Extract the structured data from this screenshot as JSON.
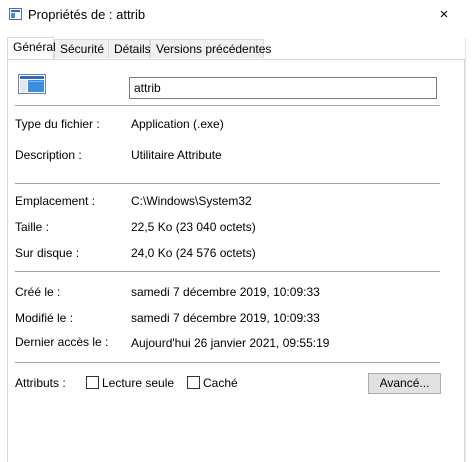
{
  "window": {
    "title": "Propriétés de : attrib",
    "close_glyph": "×"
  },
  "tabs": [
    {
      "label": "Général",
      "active": true
    },
    {
      "label": "Sécurité",
      "active": false
    },
    {
      "label": "Détails",
      "active": false
    },
    {
      "label": "Versions précédentes",
      "active": false
    }
  ],
  "general": {
    "icon": "application-window-icon",
    "file_name": "attrib",
    "rows": [
      {
        "label": "Type du fichier :",
        "value": "Application (.exe)"
      },
      {
        "label": "Description :",
        "value": "Utilitaire Attribute"
      },
      {
        "label": "Emplacement :",
        "value": "C:\\Windows\\System32"
      },
      {
        "label": "Taille :",
        "value": "22,5 Ko (23 040 octets)"
      },
      {
        "label": "Sur disque :",
        "value": "24,0 Ko (24 576 octets)"
      },
      {
        "label": "Créé le :",
        "value": "samedi 7 décembre 2019, 10:09:33"
      },
      {
        "label": "Modifié le :",
        "value": "samedi 7 décembre 2019, 10:09:33"
      },
      {
        "label": "Dernier accès le :",
        "value": "Aujourd'hui 26 janvier 2021, 09:55:19"
      }
    ],
    "attributes_label": "Attributs :",
    "readonly_label": "Lecture seule",
    "readonly_checked": false,
    "hidden_label": "Caché",
    "hidden_checked": false,
    "advanced_label": "Avancé..."
  },
  "colors": {
    "accent": "#2d6cc0",
    "separator": "#a0a0a0",
    "button_bg": "#e1e1e1"
  }
}
